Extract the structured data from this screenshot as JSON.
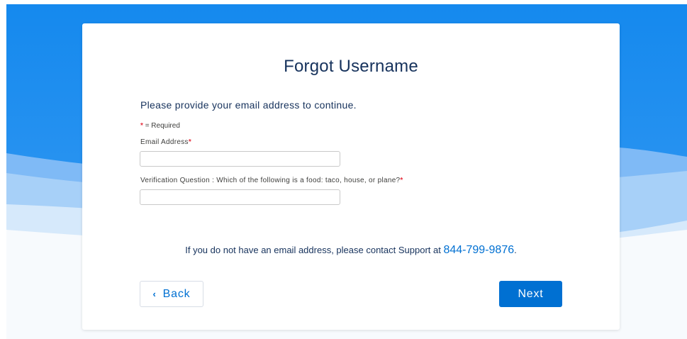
{
  "page": {
    "title": "Forgot Username",
    "intro": "Please provide your email address to continue.",
    "required_legend": {
      "marker": "*",
      "text": "= Required"
    }
  },
  "form": {
    "email": {
      "label": "Email Address",
      "value": "",
      "placeholder": ""
    },
    "verification": {
      "label": "Verification Question : Which of the following is a food: taco, house, or plane?",
      "value": "",
      "placeholder": ""
    }
  },
  "support": {
    "text": "If you do not have an email address, please contact Support at",
    "phone": "844-799-9876",
    "suffix": "."
  },
  "actions": {
    "back_icon": "chevron-left-icon",
    "back_label": "Back",
    "next_label": "Next"
  },
  "colors": {
    "brand_blue": "#0070d2",
    "background_blue": "#1589ee",
    "heading": "#16325c",
    "required": "#e5303e"
  }
}
